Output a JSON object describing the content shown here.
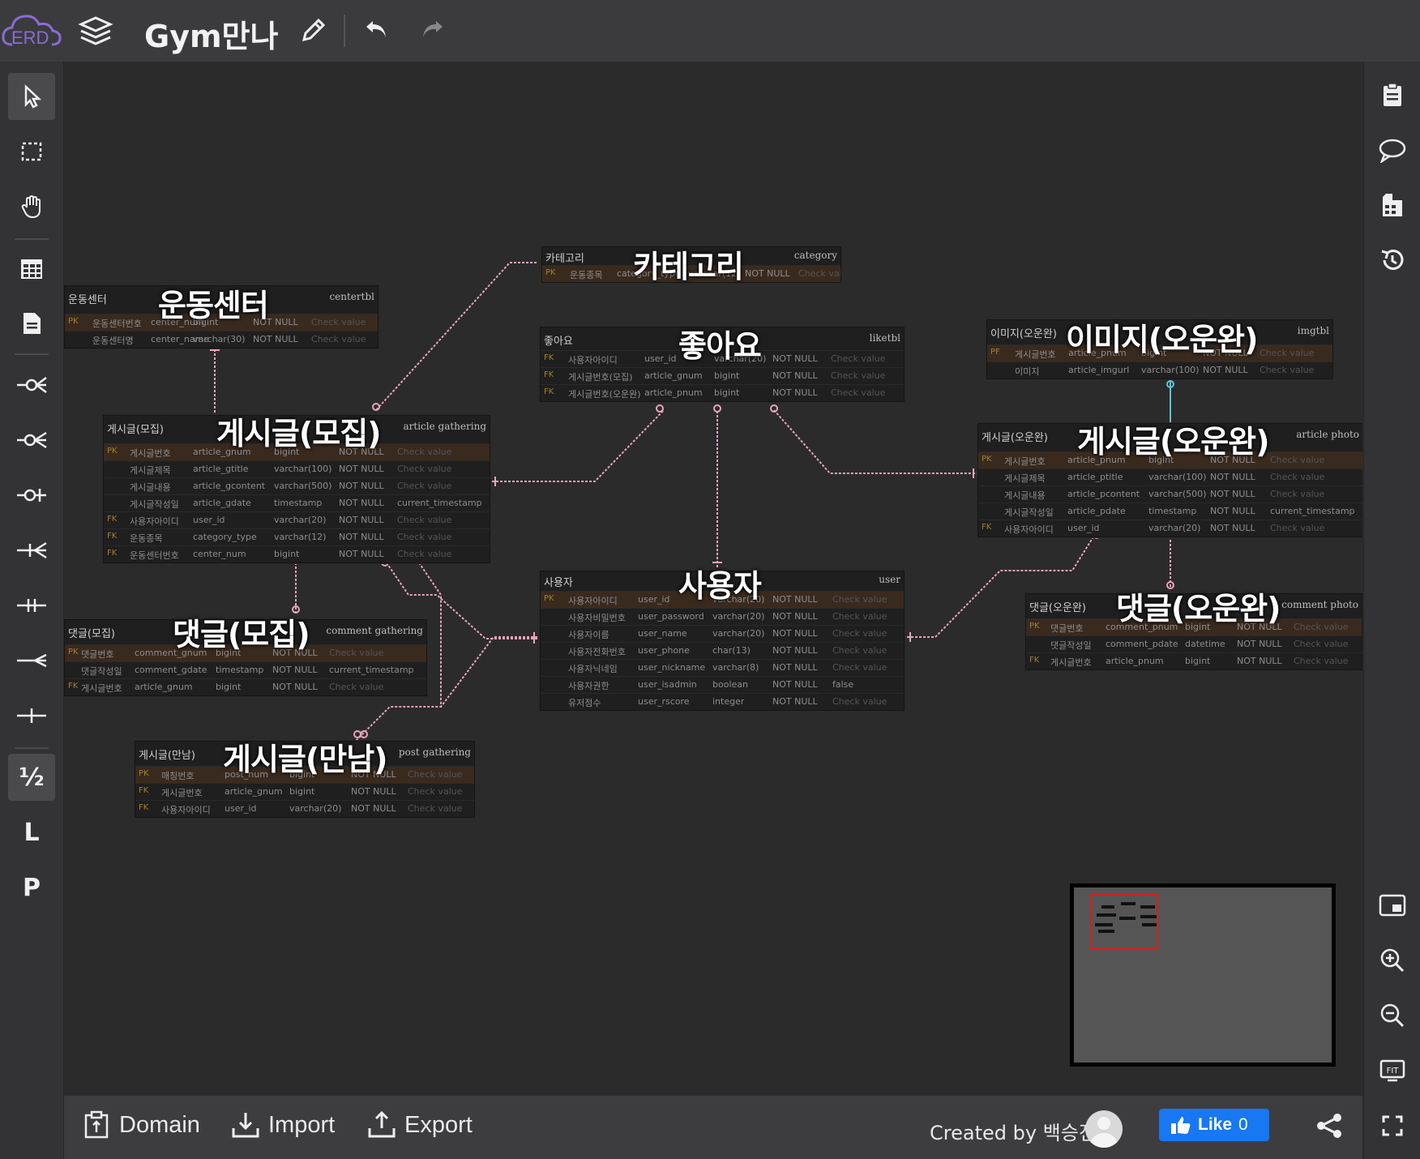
{
  "app": {
    "logo_text": "ERD",
    "title": "Gym만나"
  },
  "left_tools": [
    "pointer",
    "select",
    "hand",
    "table",
    "memo",
    "zero-or-many",
    "one-or-many",
    "zero-or-one",
    "many",
    "one-only",
    "one",
    "one-line",
    "identify",
    "relation-l",
    "relation-p"
  ],
  "left_labels": {
    "identify": "½",
    "relation_l": "L",
    "relation_p": "P"
  },
  "right_tools": [
    "clipboard-icon",
    "comment-icon",
    "film-icon",
    "history-icon"
  ],
  "right_bottom_tools": [
    "minimap-icon",
    "zoom-in-icon",
    "zoom-out-icon",
    "fit-icon",
    "fullscreen-icon"
  ],
  "tables": {
    "center": {
      "title": "운동센터",
      "logical": "운동센터",
      "physical": "centertbl",
      "rows": [
        [
          "운동센터번호",
          "center_num",
          "bigint",
          "NOT NULL",
          "Check value"
        ],
        [
          "운동센터명",
          "center_name",
          "varchar(30)",
          "NOT NULL",
          "Check value"
        ]
      ]
    },
    "category": {
      "title": "카테고리",
      "logical": "카테고리",
      "physical": "category",
      "rows": [
        [
          "운동종목",
          "category_type",
          "varchar(12)",
          "NOT NULL",
          "Check value"
        ]
      ]
    },
    "like": {
      "title": "좋아요",
      "logical": "좋아요",
      "physical": "liketbl",
      "rows": [
        [
          "사용자아이디",
          "user_id",
          "varchar(20)",
          "NOT NULL",
          "Check value"
        ],
        [
          "게시글번호(모집)",
          "article_gnum",
          "bigint",
          "NOT NULL",
          "Check value"
        ],
        [
          "게시글번호(오운완)",
          "article_pnum",
          "bigint",
          "NOT NULL",
          "Check value"
        ]
      ]
    },
    "image": {
      "title": "이미지(오운완)",
      "logical": "이미지(오운완)",
      "physical": "imgtbl",
      "rows": [
        [
          "게시글번호",
          "article_pnum",
          "bigint",
          "NOT NULL",
          "Check value"
        ],
        [
          "이미지",
          "article_imgurl",
          "varchar(100)",
          "NOT NULL",
          "Check value"
        ]
      ]
    },
    "gather": {
      "title": "게시글(모집)",
      "logical": "게시글(모집)",
      "physical": "article gathering",
      "rows": [
        [
          "게시글번호",
          "article_gnum",
          "bigint",
          "NOT NULL",
          "Check value"
        ],
        [
          "게시글제목",
          "article_gtitle",
          "varchar(100)",
          "NOT NULL",
          "Check value"
        ],
        [
          "게시글내용",
          "article_gcontent",
          "varchar(500)",
          "NOT NULL",
          "Check value"
        ],
        [
          "게시글작성일",
          "article_gdate",
          "timestamp",
          "NOT NULL",
          "current_timestamp"
        ],
        [
          "사용자아이디",
          "user_id",
          "varchar(20)",
          "NOT NULL",
          "Check value"
        ],
        [
          "운동종목",
          "category_type",
          "varchar(12)",
          "NOT NULL",
          "Check value"
        ],
        [
          "운동센터번호",
          "center_num",
          "bigint",
          "NOT NULL",
          "Check value"
        ]
      ]
    },
    "photo": {
      "title": "게시글(오운완)",
      "logical": "게시글(오운완)",
      "physical": "article photo",
      "rows": [
        [
          "게시글번호",
          "article_pnum",
          "bigint",
          "NOT NULL",
          "Check value"
        ],
        [
          "게시글제목",
          "article_ptitle",
          "varchar(100)",
          "NOT NULL",
          "Check value"
        ],
        [
          "게시글내용",
          "article_pcontent",
          "varchar(500)",
          "NOT NULL",
          "Check value"
        ],
        [
          "게시글작성일",
          "article_pdate",
          "timestamp",
          "NOT NULL",
          "current_timestamp"
        ],
        [
          "사용자아이디",
          "user_id",
          "varchar(20)",
          "NOT NULL",
          "Check value"
        ]
      ]
    },
    "user": {
      "title": "사용자",
      "logical": "사용자",
      "physical": "user",
      "rows": [
        [
          "사용자아이디",
          "user_id",
          "varchar(20)",
          "NOT NULL",
          "Check value"
        ],
        [
          "사용자비밀번호",
          "user_password",
          "varchar(20)",
          "NOT NULL",
          "Check value"
        ],
        [
          "사용자이름",
          "user_name",
          "varchar(20)",
          "NOT NULL",
          "Check value"
        ],
        [
          "사용자전화번호",
          "user_phone",
          "char(13)",
          "NOT NULL",
          "Check value"
        ],
        [
          "사용자닉네임",
          "user_nickname",
          "varchar(8)",
          "NOT NULL",
          "Check value"
        ],
        [
          "사용자권한",
          "user_isadmin",
          "boolean",
          "NOT NULL",
          "false"
        ],
        [
          "유저점수",
          "user_rscore",
          "integer",
          "NOT NULL",
          "Check value"
        ]
      ]
    },
    "comment_g": {
      "title": "댓글(모집)",
      "logical": "댓글(모집)",
      "physical": "comment gathering",
      "rows": [
        [
          "댓글번호",
          "comment_gnum",
          "bigint",
          "NOT NULL",
          "Check value"
        ],
        [
          "댓글작성일",
          "comment_gdate",
          "timestamp",
          "NOT NULL",
          "current_timestamp"
        ],
        [
          "게시글번호",
          "article_gnum",
          "bigint",
          "NOT NULL",
          "Check value"
        ]
      ]
    },
    "comment_p": {
      "title": "댓글(오운완)",
      "logical": "댓글(오운완)",
      "physical": "comment photo",
      "rows": [
        [
          "댓글번호",
          "comment_pnum",
          "bigint",
          "NOT NULL",
          "Check value"
        ],
        [
          "댓글작성일",
          "comment_pdate",
          "datetime",
          "NOT NULL",
          "Check value"
        ],
        [
          "게시글번호",
          "article_pnum",
          "bigint",
          "NOT NULL",
          "Check value"
        ]
      ]
    },
    "post_g": {
      "title": "게시글(만남)",
      "logical": "게시글(만남)",
      "physical": "post gathering",
      "rows": [
        [
          "매칭번호",
          "post_num",
          "bigint",
          "NOT NULL",
          "Check value"
        ],
        [
          "게시글번호",
          "article_gnum",
          "bigint",
          "NOT NULL",
          "Check value"
        ],
        [
          "사용자아이디",
          "user_id",
          "varchar(20)",
          "NOT NULL",
          "Check value"
        ]
      ]
    }
  },
  "bottom": {
    "domain": "Domain",
    "import": "Import",
    "export": "Export",
    "created_by": "Created by 백승진",
    "like_label": "Like",
    "like_count": "0"
  },
  "colors": {
    "relation": "#e9a3b9",
    "identify_relation": "#5ec3d6",
    "pk_row": "#3a2a1e"
  }
}
